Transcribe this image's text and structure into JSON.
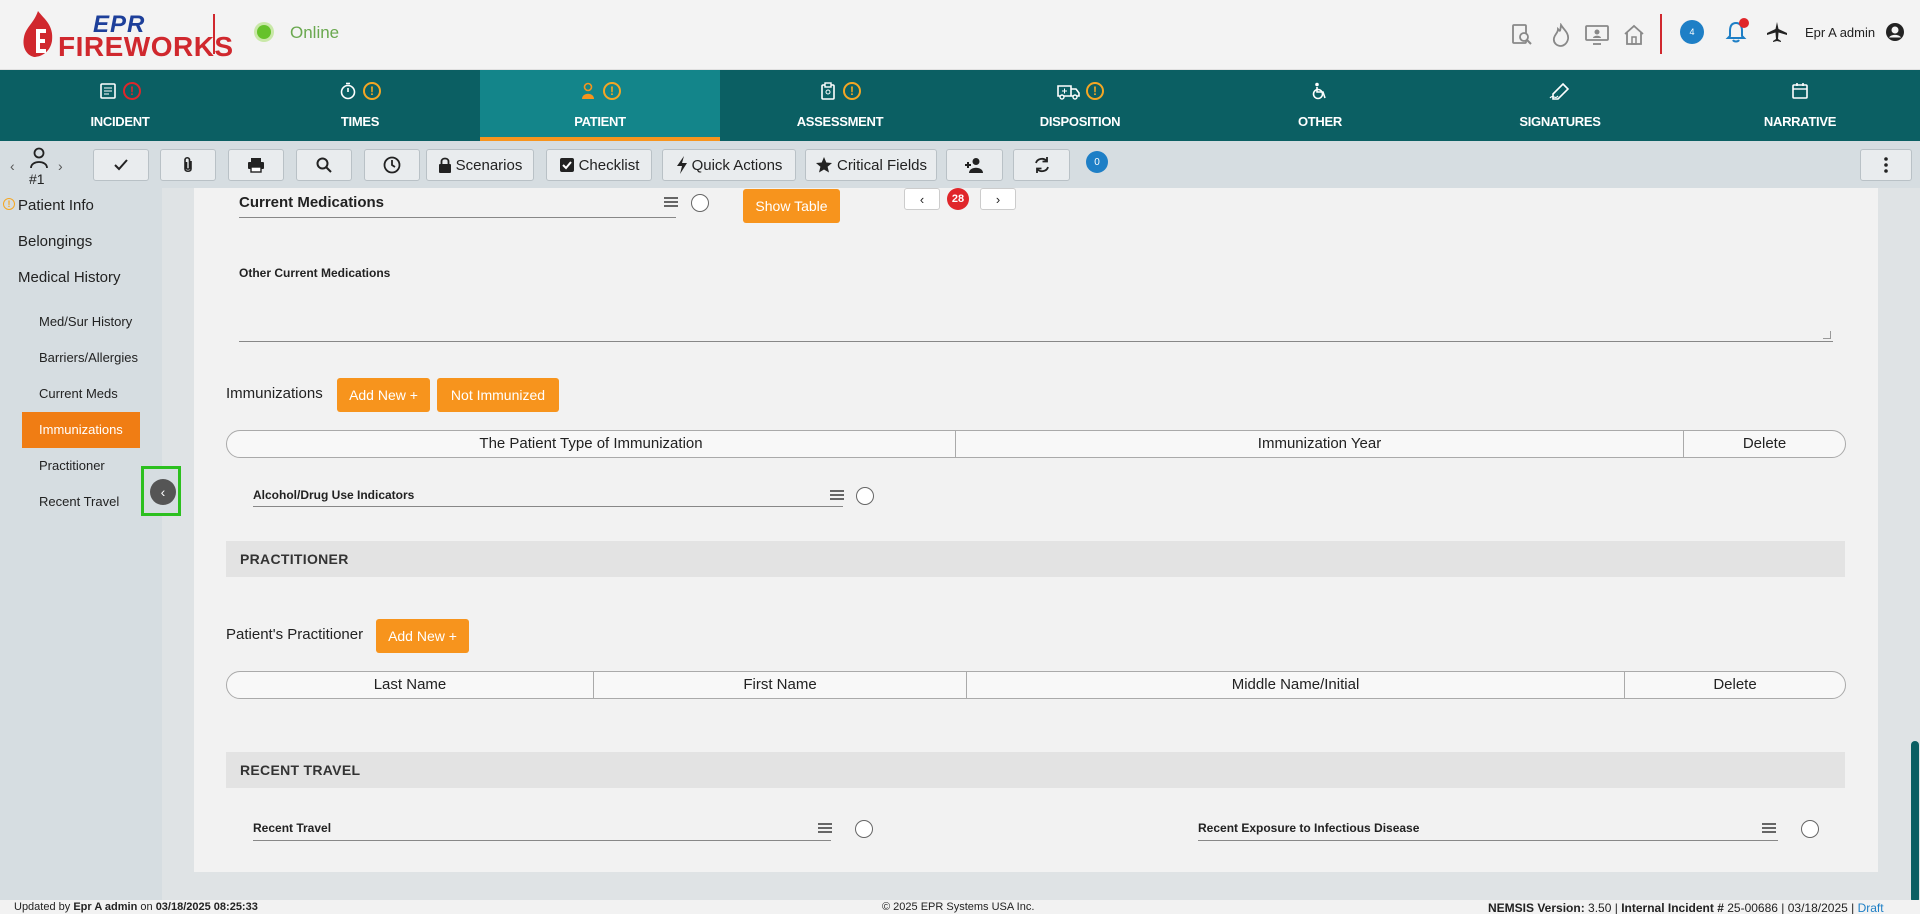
{
  "header": {
    "logo_top": "EPR",
    "logo_bottom": "FIREWORKS",
    "status": "Online",
    "chat_count": "4",
    "user_name": "Epr A admin",
    "icons": [
      "search-doc-icon",
      "fire-icon",
      "monitor-user-icon",
      "home-icon",
      "chat-icon",
      "bell-icon",
      "plane-icon",
      "user-circle-icon"
    ]
  },
  "nav": {
    "tabs": [
      {
        "label": "INCIDENT",
        "icon": "incident-icon",
        "warning": "red"
      },
      {
        "label": "TIMES",
        "icon": "stopwatch-icon",
        "warning": "orange"
      },
      {
        "label": "PATIENT",
        "icon": "patient-icon",
        "warning": "orange",
        "active": true
      },
      {
        "label": "ASSESSMENT",
        "icon": "clipboard-icon",
        "warning": "orange"
      },
      {
        "label": "DISPOSITION",
        "icon": "ambulance-icon",
        "warning": "orange"
      },
      {
        "label": "OTHER",
        "icon": "wheelchair-icon",
        "warning": ""
      },
      {
        "label": "SIGNATURES",
        "icon": "signature-icon",
        "warning": ""
      },
      {
        "label": "NARRATIVE",
        "icon": "calendar-icon",
        "warning": ""
      }
    ]
  },
  "toolbar": {
    "patient_number": "#1",
    "scenarios": "Scenarios",
    "checklist": "Checklist",
    "quick_actions": "Quick Actions",
    "critical_fields": "Critical Fields",
    "badge_count": "0"
  },
  "sidebar": {
    "patient_info": "Patient Info",
    "belongings": "Belongings",
    "medical_history": "Medical History",
    "sub_items": [
      "Med/Sur History",
      "Barriers/Allergies",
      "Current Meds",
      "Immunizations",
      "Practitioner",
      "Recent Travel"
    ],
    "active_index": 3
  },
  "main": {
    "current_medications": "Current Medications",
    "show_table": "Show Table",
    "pager_count": "28",
    "other_current_medications": "Other Current Medications",
    "immunizations_label": "Immunizations",
    "add_new": "Add New +",
    "not_immunized": "Not Immunized",
    "immunization_columns": [
      "The Patient Type of Immunization",
      "Immunization Year",
      "Delete"
    ],
    "alcohol_drug": "Alcohol/Drug Use Indicators",
    "practitioner_section": "PRACTITIONER",
    "patients_practitioner": "Patient's Practitioner",
    "practitioner_columns": [
      "Last Name",
      "First Name",
      "Middle Name/Initial",
      "Delete"
    ],
    "recent_travel_section": "RECENT TRAVEL",
    "recent_travel": "Recent Travel",
    "recent_exposure": "Recent Exposure to Infectious Disease"
  },
  "footer": {
    "updated_prefix": "Updated by",
    "updated_user": "Epr A admin",
    "updated_on": "on",
    "updated_time": "03/18/2025 08:25:33",
    "copyright": "© 2025 EPR Systems USA Inc.",
    "nemsis_label": "NEMSIS Version:",
    "nemsis_value": "3.50 |",
    "incident_label": "Internal Incident #",
    "incident_value": "25-00686 | 03/18/2025 |",
    "draft": "Draft"
  },
  "colors": {
    "brand_red": "#d0282e",
    "brand_blue": "#1d3f9a",
    "nav_teal": "#0b5f63",
    "nav_active": "#13858a",
    "accent_orange": "#f7941d",
    "online_green": "#66c22b"
  }
}
